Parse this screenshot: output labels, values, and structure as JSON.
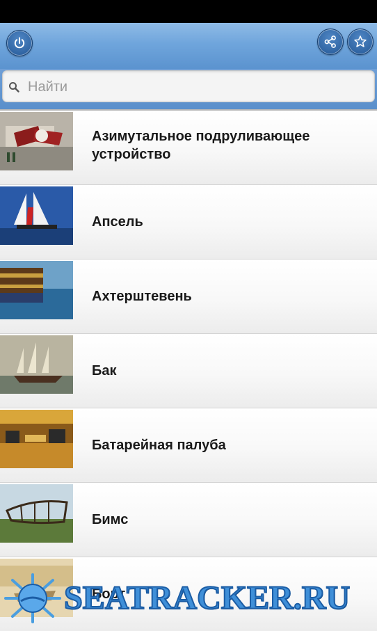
{
  "header": {
    "power_icon": "power-icon",
    "share_icon": "share-icon",
    "favorite_icon": "star-icon"
  },
  "search": {
    "placeholder": "Найти",
    "icon": "search-icon"
  },
  "items": [
    {
      "label": "Азимутальное подруливающее устройство"
    },
    {
      "label": "Апсель"
    },
    {
      "label": "Ахтерштевень"
    },
    {
      "label": "Бак"
    },
    {
      "label": "Батарейная палуба"
    },
    {
      "label": "Бимс"
    },
    {
      "label": "Борт"
    }
  ],
  "watermark": {
    "text": "SEATRACKER.RU"
  },
  "colors": {
    "header": "#6fa5dc",
    "button": "#245896",
    "watermark": "#3f8fd8"
  }
}
